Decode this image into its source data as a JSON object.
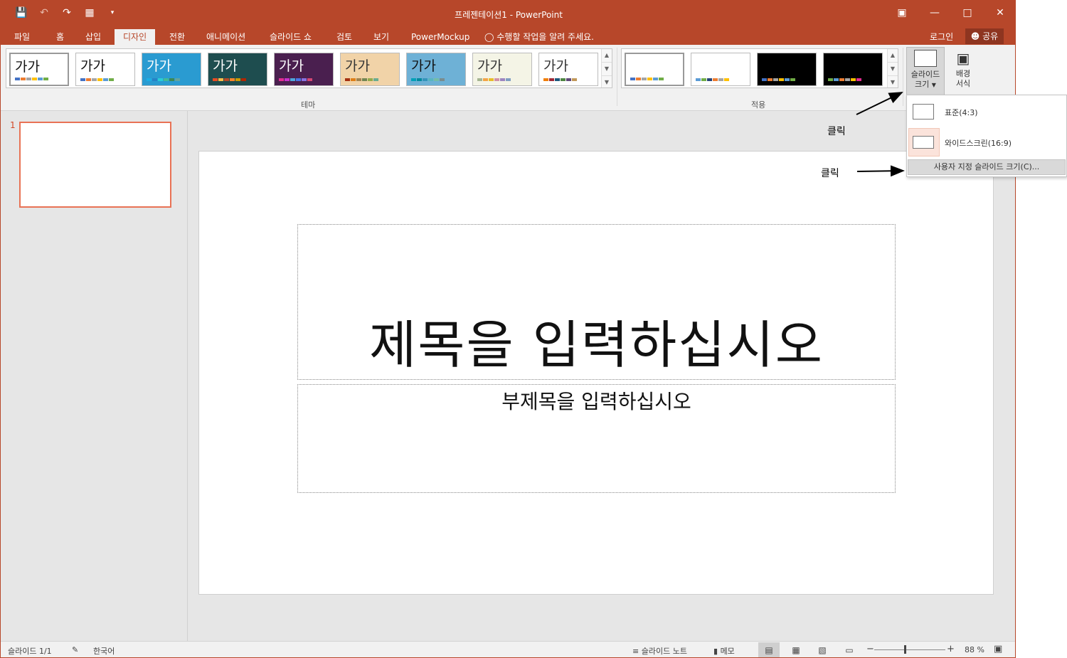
{
  "window": {
    "title": "프레젠테이션1 - PowerPoint",
    "qat": [
      "save-icon",
      "undo-icon",
      "redo-icon",
      "present-icon",
      "customize-icon"
    ],
    "controls": [
      "ribbon-display-icon",
      "minimize-icon",
      "maximize-icon",
      "close-icon"
    ]
  },
  "tabs": [
    "파일",
    "홈",
    "삽입",
    "디자인",
    "전환",
    "애니메이션",
    "슬라이드 쇼",
    "검토",
    "보기",
    "PowerMockup"
  ],
  "active_tab": "디자인",
  "tellme": "수행할 작업을 알려 주세요.",
  "login": "로그인",
  "share": "공유",
  "themes": {
    "label": "테마",
    "thumb_text": "가가",
    "items": [
      {
        "bg": "#ffffff",
        "fg": "#111111"
      },
      {
        "bg": "#ffffff",
        "fg": "#111111"
      },
      {
        "bg": "#2a9bd1",
        "fg": "#ffffff"
      },
      {
        "bg": "#1e4d4f",
        "fg": "#ffffff"
      },
      {
        "bg": "#4a1f4f",
        "fg": "#ffffff"
      },
      {
        "bg": "#f1d3a8",
        "fg": "#333333"
      },
      {
        "bg": "#6eb1d6",
        "fg": "#111111"
      },
      {
        "bg": "#f4f4e6",
        "fg": "#333333"
      },
      {
        "bg": "#ffffff",
        "fg": "#333333"
      }
    ]
  },
  "variants": {
    "label": "적용",
    "items": [
      {
        "bg": "#ffffff"
      },
      {
        "bg": "#ffffff"
      },
      {
        "bg": "#000000"
      },
      {
        "bg": "#000000"
      }
    ]
  },
  "customize": {
    "slide_size": [
      "슬라이드",
      "크기"
    ],
    "format_bg": [
      "배경",
      "서식"
    ]
  },
  "slide_size_menu": {
    "standard": "표준(4:3)",
    "widescreen": "와이드스크린(16:9)",
    "custom": "사용자 지정 슬라이드 크기(C)..."
  },
  "annotations": {
    "click1": "클릭",
    "click2": "클릭"
  },
  "slides_pane": {
    "number": "1"
  },
  "slide": {
    "title_placeholder": "제목을 입력하십시오",
    "subtitle_placeholder": "부제목을 입력하십시오"
  },
  "status": {
    "slide_count": "슬라이드 1/1",
    "language": "한국어",
    "notes": "슬라이드 노트",
    "comments": "메모",
    "zoom": "88 %"
  },
  "colors": {
    "accent": "#b7472a",
    "selection": "#e97255"
  }
}
